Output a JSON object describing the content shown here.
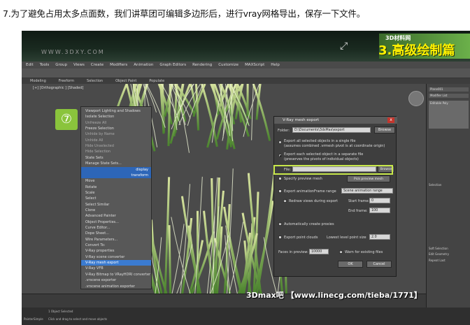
{
  "caption": "7.为了避免占用太多点面数，我们讲草团可编辑多边形后，进行vray网格导出，保存一下文件。",
  "banner": {
    "watermark": "WWW.3DXY.COM",
    "logo_small": "3D材料网",
    "logo_big": "3.高级绘制篇"
  },
  "menubar": [
    "Edit",
    "Tools",
    "Group",
    "Views",
    "Create",
    "Modifiers",
    "Animation",
    "Graph Editors",
    "Rendering",
    "Customize",
    "MAXScript",
    "Help"
  ],
  "ribbon": [
    "Modeling",
    "Freeform",
    "Selection",
    "Object Paint",
    "Populate"
  ],
  "viewport_label": "[+] [Orthographic ] [Shaded]",
  "step_badge": "⑦",
  "context_menu": [
    {
      "label": "Viewport Lighting and Shadows",
      "style": ""
    },
    {
      "label": "Isolate Selection",
      "style": ""
    },
    {
      "label": "Unfreeze All",
      "style": "dim"
    },
    {
      "label": "Freeze Selection",
      "style": ""
    },
    {
      "label": "Unhide by Name",
      "style": "dim"
    },
    {
      "label": "Unhide All",
      "style": "dim"
    },
    {
      "label": "Hide Unselected",
      "style": "dim"
    },
    {
      "label": "Hide Selection",
      "style": "dim"
    },
    {
      "label": "State Sets",
      "style": ""
    },
    {
      "label": "Manage State Sets...",
      "style": ""
    },
    {
      "label": "display",
      "style": "blue"
    },
    {
      "label": "transform",
      "style": "blue"
    },
    {
      "label": "Move",
      "style": ""
    },
    {
      "label": "Rotate",
      "style": ""
    },
    {
      "label": "Scale",
      "style": ""
    },
    {
      "label": "Select",
      "style": ""
    },
    {
      "label": "Select Similar",
      "style": ""
    },
    {
      "label": "Clone",
      "style": ""
    },
    {
      "label": "Advanced Painter",
      "style": ""
    },
    {
      "label": "Object Properties...",
      "style": ""
    },
    {
      "label": "Curve Editor...",
      "style": ""
    },
    {
      "label": "Dope Sheet...",
      "style": ""
    },
    {
      "label": "Wire Parameters...",
      "style": ""
    },
    {
      "label": "Convert To:",
      "style": ""
    },
    {
      "label": "V-Ray properties",
      "style": ""
    },
    {
      "label": "V-Ray scene converter",
      "style": ""
    },
    {
      "label": "V-Ray mesh export",
      "style": "sel"
    },
    {
      "label": "V-Ray VFB",
      "style": ""
    },
    {
      "label": "V-Ray Bitmap to VRayHDRI converter",
      "style": ""
    },
    {
      "label": ".vrscene exporter",
      "style": ""
    },
    {
      "label": ".vrscene animation exporter",
      "style": ""
    }
  ],
  "dialog": {
    "title": "V-Ray mesh export",
    "close": "x",
    "folder_label": "Folder:",
    "folder_value": "D:\\Documents\\3dsMax\\export",
    "browse1": "Browse",
    "opt1_line1": "Export all selected objects in a single file",
    "opt1_line2": "(assumes combined .vrmesh pivot is at coordinate origin)",
    "opt2_line1": "Export each selected object in a separate file",
    "opt2_line2": "(preserves the pivots of individual objects)",
    "file_label": "File:",
    "file_value": "",
    "browse2": "Browse",
    "specify_preview": "Specify preview mesh",
    "pick_preview": "Pick preview mesh",
    "export_anim": "Export animation",
    "frame_range": "Frame range",
    "range_value": "Scene animation range",
    "redraw": "Redraw views during export",
    "start_frame": "Start frame:",
    "start_value": "0",
    "end_frame": "End frame:",
    "end_value": "100",
    "auto_proxies": "Automatically create proxies",
    "export_points": "Export point clouds",
    "lowest_level": "Lowest level point size",
    "lowest_value": "2.0",
    "faces_label": "Faces in preview:",
    "faces_value": "10000",
    "warn": "Warn for existing files",
    "ok": "OK",
    "cancel": "Cancel"
  },
  "right_panel": {
    "name": "Plane001",
    "modifier_list": "Modifier List",
    "editable_poly": "Editable Poly",
    "selection": "Selection",
    "soft_selection": "Soft Selection",
    "edit_geometry": "Edit Geometry",
    "repeat_last": "Repeat Last"
  },
  "status": {
    "selected": "1 Object Selected",
    "hint": "Click and drag to select and move objects",
    "script": "PainterSimple"
  },
  "footer_watermark": "3Dmax吧 【www.linecg.com/tieba/1771】"
}
